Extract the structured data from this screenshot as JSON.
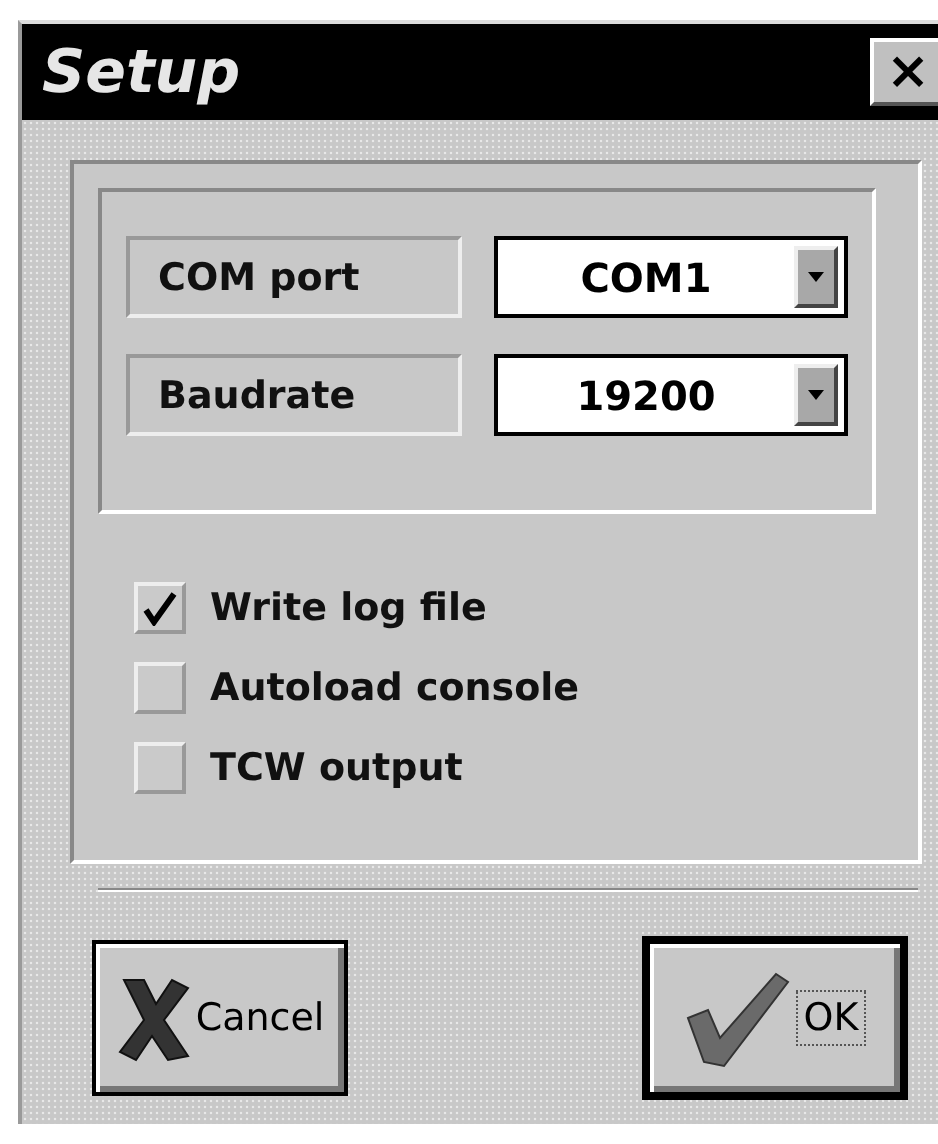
{
  "window": {
    "title": "Setup",
    "close": "×"
  },
  "settings": [
    {
      "label": "COM port",
      "value": "COM1"
    },
    {
      "label": "Baudrate",
      "value": "19200"
    }
  ],
  "options": [
    {
      "label": "Write log file",
      "checked": true
    },
    {
      "label": "Autoload console",
      "checked": false
    },
    {
      "label": "TCW output",
      "checked": false
    }
  ],
  "buttons": [
    {
      "kind": "cancel",
      "label": "Cancel",
      "default": false
    },
    {
      "kind": "ok",
      "label": "OK",
      "default": true
    }
  ]
}
